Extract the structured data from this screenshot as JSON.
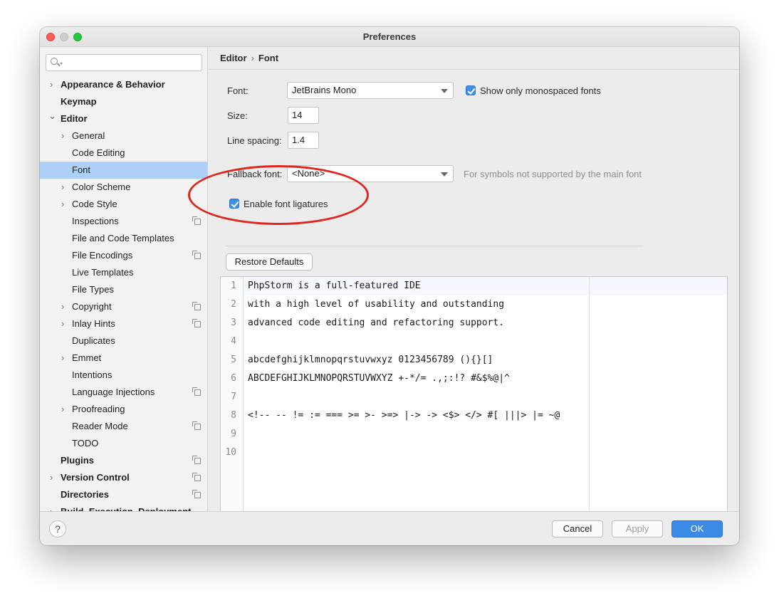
{
  "window": {
    "title": "Preferences"
  },
  "sidebar": {
    "search_placeholder": "",
    "items": [
      {
        "label": "Appearance & Behavior",
        "chevron": "›"
      },
      {
        "label": "Keymap",
        "chevron": ""
      },
      {
        "label": "Editor",
        "chevron": "⌄"
      },
      {
        "label": "General",
        "chevron": "›"
      },
      {
        "label": "Code Editing",
        "chevron": ""
      },
      {
        "label": "Font",
        "chevron": ""
      },
      {
        "label": "Color Scheme",
        "chevron": "›"
      },
      {
        "label": "Code Style",
        "chevron": "›"
      },
      {
        "label": "Inspections",
        "chevron": ""
      },
      {
        "label": "File and Code Templates",
        "chevron": ""
      },
      {
        "label": "File Encodings",
        "chevron": ""
      },
      {
        "label": "Live Templates",
        "chevron": ""
      },
      {
        "label": "File Types",
        "chevron": ""
      },
      {
        "label": "Copyright",
        "chevron": "›"
      },
      {
        "label": "Inlay Hints",
        "chevron": "›"
      },
      {
        "label": "Duplicates",
        "chevron": ""
      },
      {
        "label": "Emmet",
        "chevron": "›"
      },
      {
        "label": "Intentions",
        "chevron": ""
      },
      {
        "label": "Language Injections",
        "chevron": ""
      },
      {
        "label": "Proofreading",
        "chevron": "›"
      },
      {
        "label": "Reader Mode",
        "chevron": ""
      },
      {
        "label": "TODO",
        "chevron": ""
      },
      {
        "label": "Plugins",
        "chevron": ""
      },
      {
        "label": "Version Control",
        "chevron": "›"
      },
      {
        "label": "Directories",
        "chevron": ""
      },
      {
        "label": "Build, Execution, Deployment",
        "chevron": "›"
      }
    ]
  },
  "breadcrumb": {
    "parent": "Editor",
    "separator": "›",
    "current": "Font"
  },
  "form": {
    "font_label": "Font:",
    "font_value": "JetBrains Mono",
    "show_mono_label": "Show only monospaced fonts",
    "size_label": "Size:",
    "size_value": "14",
    "line_spacing_label": "Line spacing:",
    "line_spacing_value": "1.4",
    "fallback_label": "Fallback font:",
    "fallback_value": "<None>",
    "fallback_hint": "For symbols not supported by the main font",
    "ligatures_label": "Enable font ligatures",
    "restore_label": "Restore Defaults"
  },
  "preview": {
    "line_numbers": [
      "1",
      "2",
      "3",
      "4",
      "5",
      "6",
      "7",
      "8",
      "9",
      "10"
    ],
    "lines": [
      "PhpStorm is a full-featured IDE",
      "with a high level of usability and outstanding",
      "advanced code editing and refactoring support.",
      "",
      "abcdefghijklmnopqrstuvwxyz 0123456789 (){}[]",
      "ABCDEFGHIJKLMNOPQRSTUVWXYZ +-*/= .,;:!? #&$%@|^",
      "",
      "<!-- -- != := === >= >- >=> |-> -> <$> </> #[ |||> |= ~@",
      "",
      ""
    ]
  },
  "footer": {
    "help_label": "?",
    "cancel_label": "Cancel",
    "apply_label": "Apply",
    "ok_label": "OK"
  },
  "colors": {
    "selection": "#acd0f8",
    "accent": "#3b8ae6",
    "annotation": "#e0261f"
  }
}
